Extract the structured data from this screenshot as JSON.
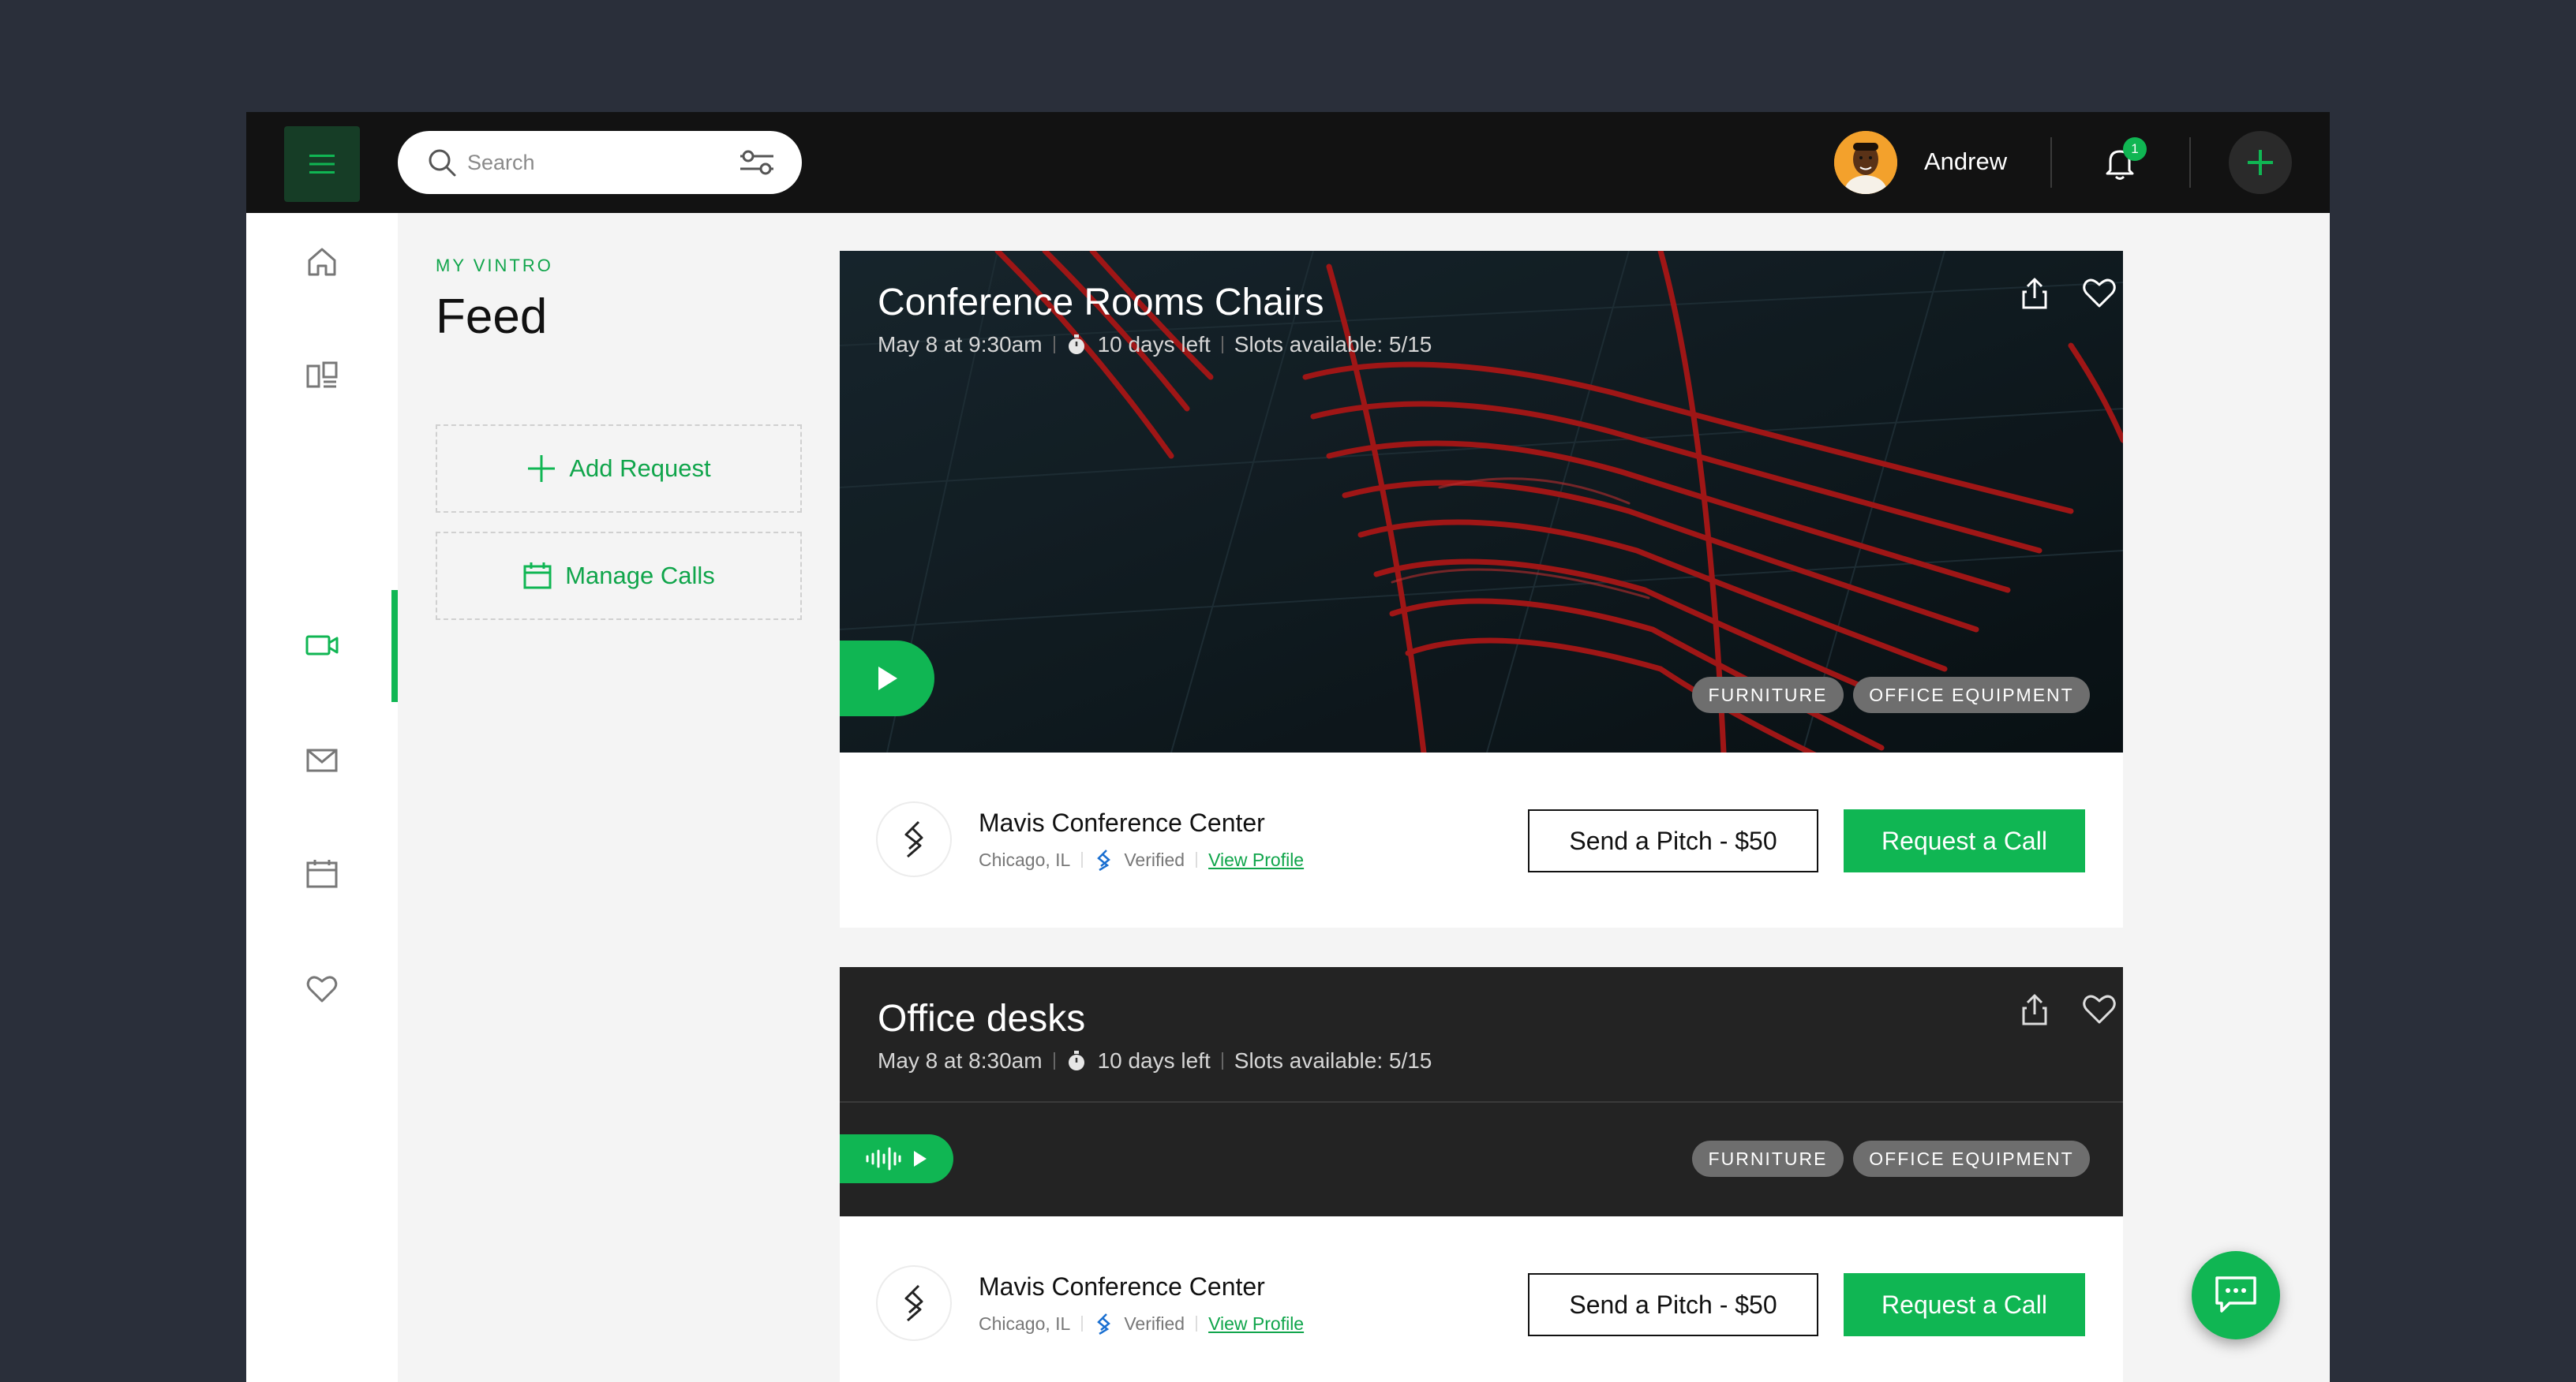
{
  "header": {
    "search_placeholder": "Search",
    "user_name": "Andrew",
    "notification_count": "1"
  },
  "sidebar": {
    "items": [
      {
        "icon": "home-icon",
        "active": false
      },
      {
        "icon": "dashboard-icon",
        "active": false
      },
      {
        "icon": "video-icon",
        "active": true
      },
      {
        "icon": "mail-icon",
        "active": false
      },
      {
        "icon": "calendar-icon",
        "active": false
      },
      {
        "icon": "heart-icon",
        "active": false
      }
    ]
  },
  "page": {
    "eyebrow": "MY VINTRO",
    "title": "Feed",
    "actions": {
      "add_request": "Add Request",
      "manage_calls": "Manage Calls"
    }
  },
  "feed": [
    {
      "title": "Conference Rooms Chairs",
      "date": "May 8 at 9:30am",
      "time_left": "10 days left",
      "slots": "Slots available: 5/15",
      "media": "video",
      "tags": [
        "FURNITURE",
        "OFFICE EQUIPMENT"
      ],
      "org": {
        "name": "Mavis Conference Center",
        "location": "Chicago, IL",
        "verified": "Verified",
        "profile_link": "View Profile"
      },
      "pitch_label": "Send a Pitch - $50",
      "call_label": "Request a Call"
    },
    {
      "title": "Office desks",
      "date": "May 8 at 8:30am",
      "time_left": "10 days left",
      "slots": "Slots available: 5/15",
      "media": "audio",
      "tags": [
        "FURNITURE",
        "OFFICE EQUIPMENT"
      ],
      "org": {
        "name": "Mavis Conference Center",
        "location": "Chicago, IL",
        "verified": "Verified",
        "profile_link": "View Profile"
      },
      "pitch_label": "Send a Pitch - $50",
      "call_label": "Request a Call"
    }
  ],
  "colors": {
    "accent": "#10b653",
    "page_background": "#2a2f3a",
    "topbar": "#121212",
    "tag": "#6e6e6e"
  }
}
